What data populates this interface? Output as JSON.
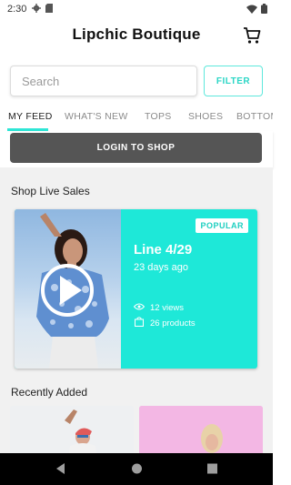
{
  "status_bar": {
    "time": "2:30"
  },
  "header": {
    "title": "Lipchic Boutique"
  },
  "search": {
    "placeholder": "Search",
    "value": "",
    "filter_label": "FILTER"
  },
  "tabs": [
    {
      "label": "MY FEED",
      "active": true
    },
    {
      "label": "WHAT'S NEW",
      "active": false
    },
    {
      "label": "TOPS",
      "active": false
    },
    {
      "label": "SHOES",
      "active": false
    },
    {
      "label": "BOTTOMS",
      "active": false
    }
  ],
  "login": {
    "label": "LOGIN TO SHOP"
  },
  "live_sales": {
    "section_title": "Shop Live Sales",
    "card": {
      "badge": "POPULAR",
      "title": "Line 4/29",
      "subtitle": "23 days ago",
      "views": "12 views",
      "products": "26 products"
    }
  },
  "recent": {
    "section_title": "Recently Added"
  },
  "colors": {
    "accent": "#2ee6d6",
    "card_bg": "#1ee8d8",
    "login_button": "#555555"
  },
  "icons": [
    "settings-icon",
    "sd-card-icon",
    "wifi-icon",
    "battery-icon",
    "cart-icon",
    "play-icon",
    "eye-icon",
    "bag-icon",
    "back-nav-icon",
    "home-nav-icon",
    "recents-nav-icon"
  ]
}
